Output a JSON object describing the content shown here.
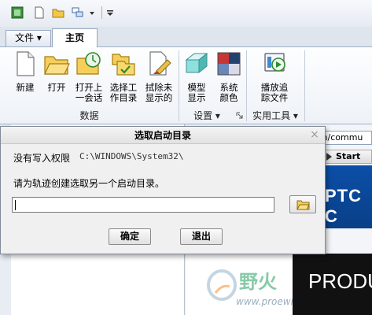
{
  "quick_access": {
    "icons": [
      "window-icon",
      "new-file-icon",
      "open-folder-icon",
      "windows-switch-icon",
      "dropdown-arrow-icon",
      "customize-icon"
    ]
  },
  "tabs": [
    {
      "label": "文件 ▾",
      "active": false
    },
    {
      "label": "主页",
      "active": true
    }
  ],
  "ribbon": {
    "data_group": {
      "label": "数据",
      "buttons": [
        {
          "label": "新建",
          "icon": "new-file-icon"
        },
        {
          "label": "打开",
          "icon": "open-folder-icon"
        },
        {
          "label": "打开上\n一会话",
          "icon": "open-last-session-icon"
        },
        {
          "label": "选择工\n作目录",
          "icon": "select-working-dir-icon"
        },
        {
          "label": "拭除未\n显示的",
          "icon": "erase-not-displayed-icon"
        }
      ]
    },
    "settings_group": {
      "label": "设置 ▾",
      "buttons": [
        {
          "label": "模型\n显示",
          "icon": "model-display-icon"
        },
        {
          "label": "系统\n颜色",
          "icon": "system-colors-icon"
        }
      ]
    },
    "tools_group": {
      "label": "实用工具 ▾",
      "buttons": [
        {
          "label": "播放追\n踪文件",
          "icon": "play-trail-file-icon"
        }
      ]
    }
  },
  "background": {
    "address_text": "com/commu",
    "start_label": "Start",
    "ptc_text": "PTC C",
    "product_text": "PRODUC",
    "watermark_text": "野火",
    "watermark_url": "www.proewildfire.cn"
  },
  "dialog": {
    "title": "选取启动目录",
    "close_glyph": "×",
    "no_write_permission": "没有写入权限",
    "path": "C:\\WINDOWS\\System32\\",
    "prompt": "请为轨迹创建选取另一个启动目录。",
    "input_value": "",
    "ok_label": "确定",
    "exit_label": "退出"
  },
  "colors": {
    "ribbon_bg": "#eef2f7",
    "dialog_bg": "#f0f0f0",
    "ptc_blue": "#0b4fa8"
  }
}
